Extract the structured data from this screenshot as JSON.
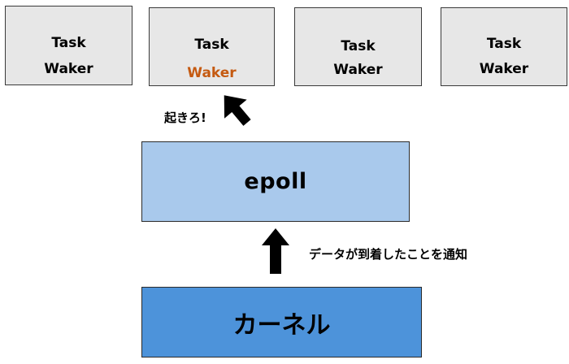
{
  "tasks": [
    {
      "task_label": "Task",
      "waker_label": "Waker",
      "waker_color": "#000000"
    },
    {
      "task_label": "Task",
      "waker_label": "Waker",
      "waker_color": "#c55a11"
    },
    {
      "task_label": "Task",
      "waker_label": "Waker",
      "waker_color": "#000000"
    },
    {
      "task_label": "Task",
      "waker_label": "Waker",
      "waker_color": "#000000"
    }
  ],
  "epoll": {
    "label": "epoll",
    "fill": "#a9c9ec"
  },
  "kernel": {
    "label": "カーネル",
    "fill": "#4d93da"
  },
  "wake_message": "起きろ!",
  "notify_message": "データが到着したことを通知"
}
